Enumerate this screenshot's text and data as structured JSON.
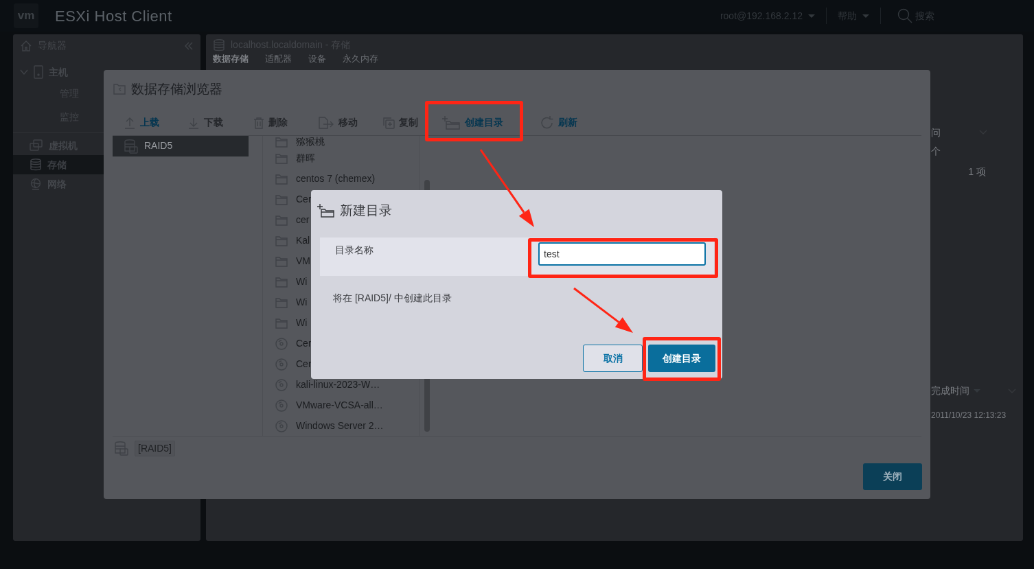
{
  "app": {
    "logo": "vm",
    "title": "ESXi Host Client",
    "user": "root@192.168.2.12",
    "help": "帮助",
    "search": "搜索"
  },
  "navigator": {
    "title": "导航器",
    "items": [
      {
        "label": "主机",
        "kind": "host",
        "expanded": true,
        "selected": false,
        "children": [
          {
            "label": "管理",
            "selected": false
          },
          {
            "label": "监控",
            "selected": false
          }
        ]
      },
      {
        "label": "虚拟机",
        "kind": "vm",
        "selected": false
      },
      {
        "label": "存储",
        "kind": "storage",
        "selected": true
      },
      {
        "label": "网络",
        "kind": "network",
        "selected": false
      }
    ]
  },
  "content": {
    "title": "localhost.localdomain - 存储",
    "tabs": [
      {
        "label": "数据存储",
        "selected": true
      },
      {
        "label": "适配器",
        "selected": false
      },
      {
        "label": "设备",
        "selected": false
      },
      {
        "label": "永久内存",
        "selected": false
      }
    ],
    "fragments": {
      "column_header": "问",
      "cell": "个",
      "count": "1 项",
      "tasks_header": "完成时间",
      "tasks_time": "2011/10/23 12:13:23"
    }
  },
  "browser": {
    "title": "数据存储浏览器",
    "toolbar": [
      {
        "label": "上载",
        "kind": "upload",
        "disabled": false
      },
      {
        "label": "下载",
        "kind": "download",
        "disabled": true
      },
      {
        "label": "删除",
        "kind": "delete",
        "disabled": true
      },
      {
        "label": "移动",
        "kind": "move",
        "disabled": true
      },
      {
        "label": "复制",
        "kind": "copy",
        "disabled": true
      },
      {
        "label": "创建目录",
        "kind": "newfolder",
        "disabled": false
      },
      {
        "label": "刷新",
        "kind": "refresh",
        "disabled": false
      }
    ],
    "datastores": [
      {
        "label": "RAID5",
        "selected": true
      }
    ],
    "files": [
      {
        "name": "猕猴桃",
        "kind": "folder"
      },
      {
        "name": "群晖",
        "kind": "folder"
      },
      {
        "name": "centos 7 (chemex)",
        "kind": "folder"
      },
      {
        "name": "Cer",
        "kind": "folder"
      },
      {
        "name": "cer",
        "kind": "folder"
      },
      {
        "name": "Kal",
        "kind": "folder"
      },
      {
        "name": "VM",
        "kind": "folder"
      },
      {
        "name": "Wi",
        "kind": "folder"
      },
      {
        "name": "Wi",
        "kind": "folder"
      },
      {
        "name": "Wi",
        "kind": "folder"
      },
      {
        "name": "Cer",
        "kind": "disc"
      },
      {
        "name": "Cer",
        "kind": "disc"
      },
      {
        "name": "kali-linux-2023-W…",
        "kind": "disc"
      },
      {
        "name": "VMware-VCSA-all…",
        "kind": "disc"
      },
      {
        "name": "Windows Server 2…",
        "kind": "disc"
      }
    ],
    "path": "[RAID5]",
    "close": "关闭"
  },
  "new_folder": {
    "title": "新建目录",
    "field_label": "目录名称",
    "value": "test",
    "note": "将在 [RAID5]/ 中创建此目录",
    "cancel": "取消",
    "create": "创建目录"
  }
}
